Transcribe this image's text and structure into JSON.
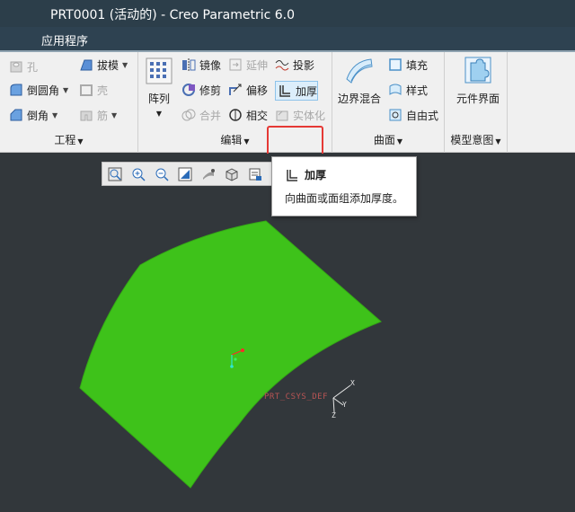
{
  "window": {
    "title": "PRT0001 (活动的) - Creo Parametric 6.0"
  },
  "menubar": {
    "app_menu": "应用程序"
  },
  "ribbon": {
    "groups": {
      "engineering": {
        "label": "工程",
        "hole": "孔",
        "draft": "拔模",
        "round": "倒圆角",
        "shell": "壳",
        "chamfer": "倒角",
        "rib": "筋"
      },
      "editing": {
        "label": "编辑",
        "pattern": "阵列",
        "mirror": "镜像",
        "extend": "延伸",
        "project": "投影",
        "trim": "修剪",
        "offset": "偏移",
        "thicken": "加厚",
        "merge": "合并",
        "intersect": "相交",
        "solidify": "实体化"
      },
      "surfaces": {
        "label": "曲面",
        "boundary_blend": "边界混合",
        "fill": "填充",
        "style": "样式",
        "freestyle": "自由式"
      },
      "model_intent": {
        "label": "模型意图",
        "component_interface": "元件界面"
      }
    }
  },
  "tooltip": {
    "title": "加厚",
    "description": "向曲面或面组添加厚度。"
  },
  "viewport": {
    "csys_label": "PRT_CSYS_DEF",
    "axis_x": "X",
    "axis_y": "Y",
    "axis_z": "Z",
    "surface_color": "#3ec21a",
    "background_color": "#32373b"
  },
  "view_toolbar": {
    "icons": [
      "refit-icon",
      "zoom-in-icon",
      "zoom-out-icon",
      "repaint-icon",
      "perspective-icon",
      "saved-views-icon",
      "display-style-icon"
    ]
  }
}
